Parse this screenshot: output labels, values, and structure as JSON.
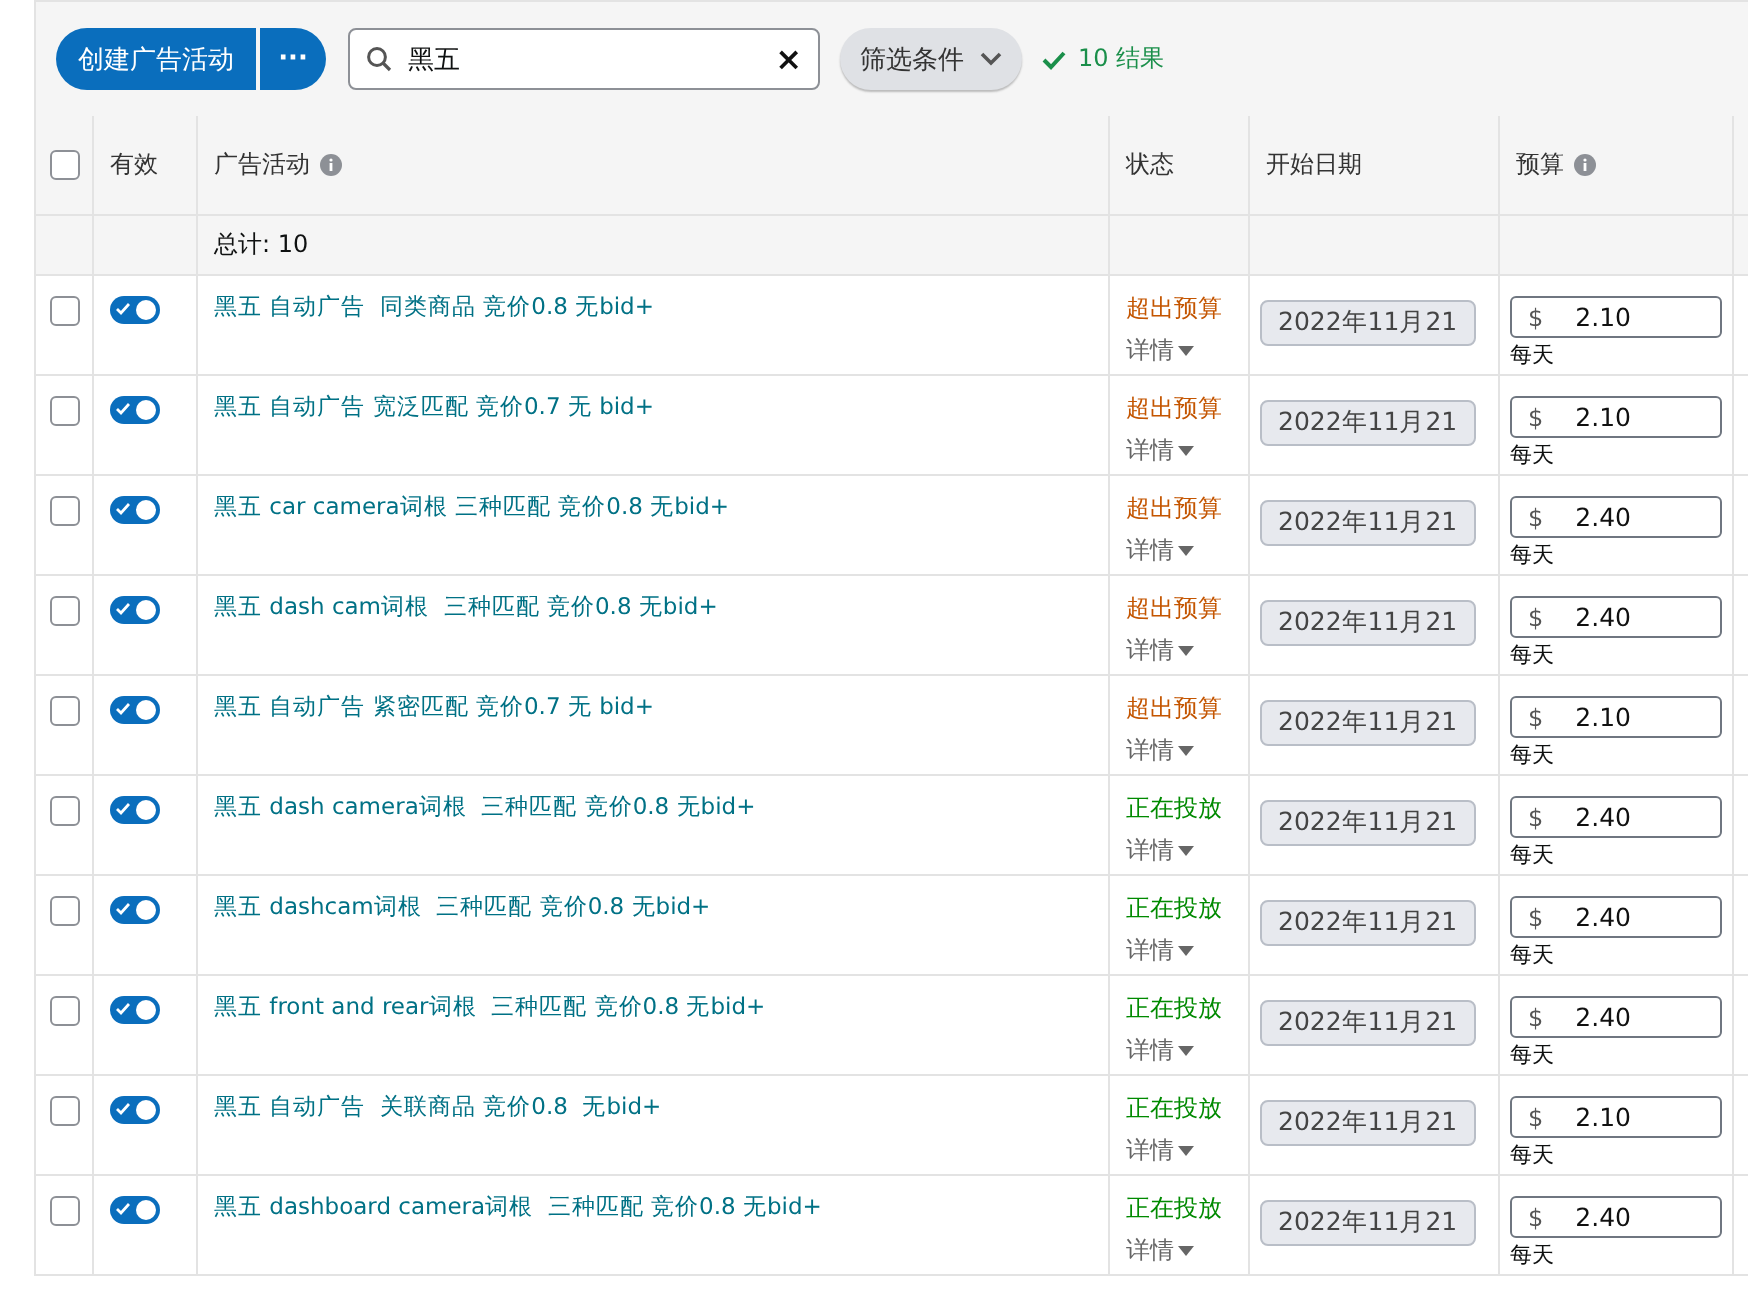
{
  "toolbar": {
    "create_button": "创建广告活动",
    "more_button": "···",
    "search": {
      "value": "黑五",
      "clear": "×"
    },
    "filter_button": "筛选条件",
    "result_count": "10 结果"
  },
  "table": {
    "select_all_checked": false,
    "columns": [
      {
        "label": "有效",
        "info": false
      },
      {
        "label": "广告活动",
        "info": true
      },
      {
        "label": "状态",
        "info": false
      },
      {
        "label": "开始日期",
        "info": false
      },
      {
        "label": "预算",
        "info": true
      }
    ],
    "total": "总计: 10",
    "rows": [
      {
        "checked": false,
        "enabled": true,
        "campaign": "黑五 自动广告  同类商品 竞价0.8 无bid+",
        "status": {
          "kind": "over_budget",
          "label": "超出预算"
        },
        "details": "详情",
        "start_date": "2022年11月21",
        "currency": "$",
        "budget": "2.10",
        "period": "每天"
      },
      {
        "checked": false,
        "enabled": true,
        "campaign": "黑五 自动广告 宽泛匹配 竞价0.7 无 bid+",
        "status": {
          "kind": "over_budget",
          "label": "超出预算"
        },
        "details": "详情",
        "start_date": "2022年11月21",
        "currency": "$",
        "budget": "2.10",
        "period": "每天"
      },
      {
        "checked": false,
        "enabled": true,
        "campaign": "黑五 car camera词根 三种匹配 竞价0.8 无bid+",
        "status": {
          "kind": "over_budget",
          "label": "超出预算"
        },
        "details": "详情",
        "start_date": "2022年11月21",
        "currency": "$",
        "budget": "2.40",
        "period": "每天"
      },
      {
        "checked": false,
        "enabled": true,
        "campaign": "黑五 dash cam词根  三种匹配 竞价0.8 无bid+",
        "status": {
          "kind": "over_budget",
          "label": "超出预算"
        },
        "details": "详情",
        "start_date": "2022年11月21",
        "currency": "$",
        "budget": "2.40",
        "period": "每天"
      },
      {
        "checked": false,
        "enabled": true,
        "campaign": "黑五 自动广告 紧密匹配 竞价0.7 无 bid+",
        "status": {
          "kind": "over_budget",
          "label": "超出预算"
        },
        "details": "详情",
        "start_date": "2022年11月21",
        "currency": "$",
        "budget": "2.10",
        "period": "每天"
      },
      {
        "checked": false,
        "enabled": true,
        "campaign": "黑五 dash camera词根  三种匹配 竞价0.8 无bid+",
        "status": {
          "kind": "delivering",
          "label": "正在投放"
        },
        "details": "详情",
        "start_date": "2022年11月21",
        "currency": "$",
        "budget": "2.40",
        "period": "每天"
      },
      {
        "checked": false,
        "enabled": true,
        "campaign": "黑五 dashcam词根  三种匹配 竞价0.8 无bid+",
        "status": {
          "kind": "delivering",
          "label": "正在投放"
        },
        "details": "详情",
        "start_date": "2022年11月21",
        "currency": "$",
        "budget": "2.40",
        "period": "每天"
      },
      {
        "checked": false,
        "enabled": true,
        "campaign": "黑五 front and rear词根  三种匹配 竞价0.8 无bid+",
        "status": {
          "kind": "delivering",
          "label": "正在投放"
        },
        "details": "详情",
        "start_date": "2022年11月21",
        "currency": "$",
        "budget": "2.40",
        "period": "每天"
      },
      {
        "checked": false,
        "enabled": true,
        "campaign": "黑五 自动广告  关联商品 竞价0.8  无bid+",
        "status": {
          "kind": "delivering",
          "label": "正在投放"
        },
        "details": "详情",
        "start_date": "2022年11月21",
        "currency": "$",
        "budget": "2.10",
        "period": "每天"
      },
      {
        "checked": false,
        "enabled": true,
        "campaign": "黑五 dashboard camera词根  三种匹配 竞价0.8 无bid+",
        "status": {
          "kind": "delivering",
          "label": "正在投放"
        },
        "details": "详情",
        "start_date": "2022年11月21",
        "currency": "$",
        "budget": "2.40",
        "period": "每天"
      }
    ]
  }
}
